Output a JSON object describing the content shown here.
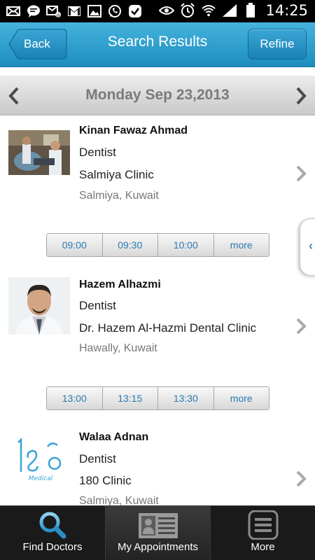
{
  "status_bar": {
    "time": "14:25",
    "left_icons": [
      "mail-icon",
      "chat-icon",
      "email-notification-icon",
      "gmail-icon",
      "image-icon",
      "whatsapp-icon",
      "check-icon"
    ],
    "right_icons": [
      "eye-icon",
      "alarm-icon",
      "wifi-icon",
      "signal-icon",
      "battery-icon"
    ]
  },
  "header": {
    "back_label": "Back",
    "title": "Search Results",
    "refine_label": "Refine"
  },
  "date_bar": {
    "date": "Monday Sep 23,2013"
  },
  "results": [
    {
      "name": "Kinan Fawaz Ahmad",
      "specialty": "Dentist",
      "clinic": "Salmiya Clinic",
      "location": "Salmiya, Kuwait",
      "slots": [
        "09:00",
        "09:30",
        "10:00",
        "more"
      ]
    },
    {
      "name": "Hazem  Alhazmi",
      "specialty": "Dentist",
      "clinic": "Dr. Hazem Al-Hazmi Dental Clinic",
      "location": "Hawally, Kuwait",
      "slots": [
        "13:00",
        "13:15",
        "13:30",
        "more"
      ]
    },
    {
      "name": "Walaa  Adnan",
      "specialty": "Dentist",
      "clinic": "180 Clinic",
      "location": "Salmiya, Kuwait",
      "logo_text": "Medical"
    }
  ],
  "tab_bar": {
    "tabs": [
      {
        "label": "Find Doctors",
        "icon": "magnifier-icon"
      },
      {
        "label": "My Appointments",
        "icon": "appointments-card-icon"
      },
      {
        "label": "More",
        "icon": "more-list-icon"
      }
    ],
    "active": "My Appointments"
  },
  "colors": {
    "header_top": "#46b3dd",
    "header_bottom": "#1d8dbf",
    "slot_text": "#2a7ab0",
    "tabbar": "#1a1a1a"
  }
}
